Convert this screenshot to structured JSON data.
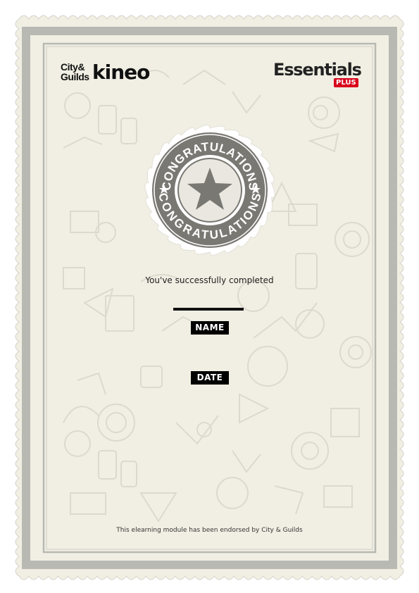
{
  "logos": {
    "cityguilds_line1": "City&",
    "cityguilds_line2": "Guilds",
    "kineo": "kineo",
    "essentials": "Essentials",
    "plus": "PLUS"
  },
  "badge": {
    "top_text": "CONGRATULATIONS",
    "bottom_text": "CONGRATULATIONS"
  },
  "certificate": {
    "completed_text": "You've successfully completed",
    "name_label": "NAME",
    "date_label": "DATE",
    "footer_text": "This elearning module has been endorsed by City & Guilds"
  },
  "colors": {
    "paper": "#f1efe3",
    "border_gray": "#b9b9b4",
    "badge_gray": "#7a7873",
    "accent_red": "#d9001b"
  }
}
